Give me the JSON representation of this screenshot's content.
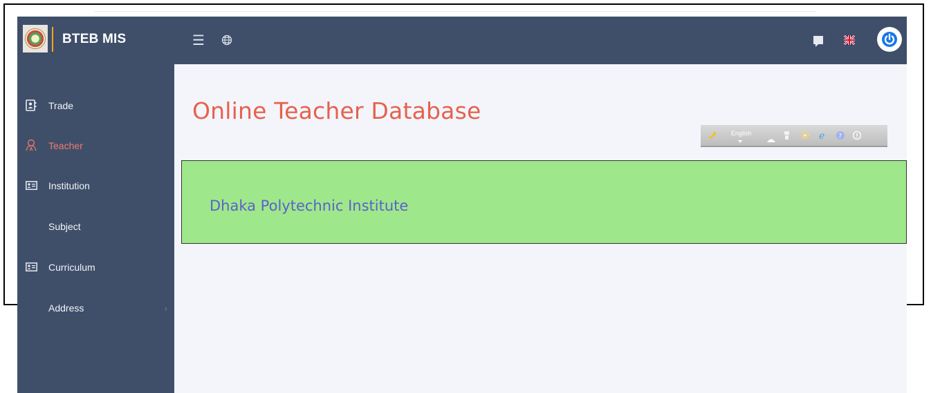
{
  "header": {
    "app_title": "BTEB MIS",
    "icons": [
      "menu-icon",
      "globe-icon",
      "message-icon",
      "uk-flag-icon",
      "power-icon"
    ]
  },
  "sidebar": {
    "items": [
      {
        "label": "Trade",
        "icon": "contact-card-icon"
      },
      {
        "label": "Teacher",
        "icon": "teacher-icon",
        "active": true
      },
      {
        "label": "Institution",
        "icon": "id-card-icon"
      },
      {
        "label": "Subject",
        "icon": ""
      },
      {
        "label": "Curriculum",
        "icon": "id-card-icon"
      },
      {
        "label": "Address",
        "icon": "",
        "has_submenu": true
      }
    ]
  },
  "main": {
    "page_title": "Online Teacher Database",
    "toolbar": {
      "language": "English",
      "icons": [
        "sound-icon",
        "language-select",
        "hat-icon",
        "figure-icon",
        "gear-icon",
        "ie-icon",
        "help-icon",
        "info-icon"
      ]
    },
    "institution_name": "Dhaka Polytechnic Institute"
  },
  "colors": {
    "header_bg": "#3f4f6a",
    "sidebar_bg": "#3f4f6a",
    "active_item": "#f07a6a",
    "title": "#e5614e",
    "panel_bg": "#9fe78b",
    "institution_text": "#5a63c8",
    "accent_power": "#1677e5"
  }
}
